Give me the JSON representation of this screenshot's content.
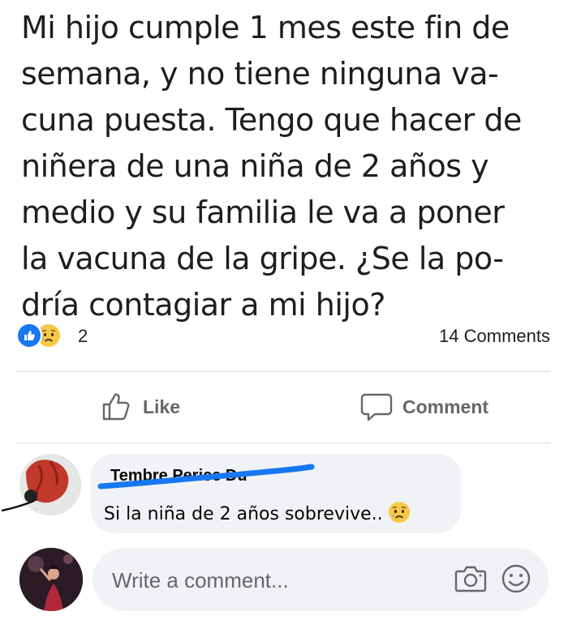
{
  "post": {
    "lines": [
      "Mi hijo cumple 1 mes este fin de",
      "semana, y no tiene ninguna va-",
      "cuna puesta. Tengo que hacer de",
      "niñera de una niña de 2 años y",
      "medio y su familia le va a poner",
      "la vacuna de la gripe. ¿Se la po-",
      "dría contagiar a mi hijo?"
    ]
  },
  "reactions": {
    "icons": [
      "like-icon",
      "sad-face-icon"
    ],
    "count": "2",
    "comments_label": "14 Comments"
  },
  "actions": {
    "like_label": "Like",
    "comment_label": "Comment"
  },
  "comment": {
    "author": "Tembre Perice Du",
    "text": "Si la niña de 2 años sobrevive..",
    "emoji": "worried-face-icon"
  },
  "composer": {
    "placeholder": "Write a comment...",
    "icons": [
      "camera-icon",
      "smiley-icon"
    ]
  },
  "colors": {
    "brand_blue": "#1877f2",
    "muted_gray": "#65676b",
    "bubble_bg": "#f0f2f5",
    "divider": "#dadde1"
  }
}
